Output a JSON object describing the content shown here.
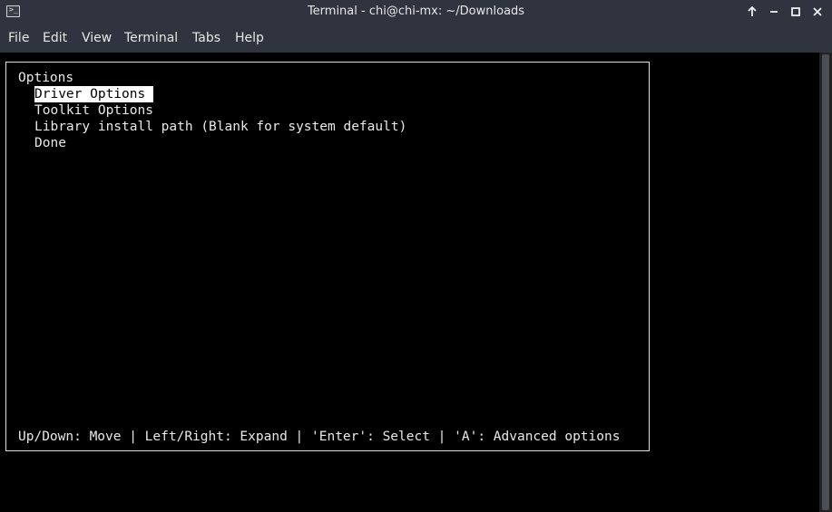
{
  "window": {
    "title": "Terminal - chi@chi-mx: ~/Downloads",
    "app_icon_glyph": ">_",
    "buttons": {
      "keep_above_icon": "arrow-up",
      "minimize_glyph": "−",
      "maximize_icon": "square",
      "close_glyph": "✕"
    }
  },
  "menubar": {
    "items": [
      "File",
      "Edit",
      "View",
      "Terminal",
      "Tabs",
      "Help"
    ]
  },
  "terminal": {
    "heading": "Options",
    "options": [
      "Driver Options",
      "Toolkit Options",
      "Library install path (Blank for system default)",
      "Done"
    ],
    "selected_index": 0,
    "footer": "Up/Down: Move | Left/Right: Expand | 'Enter': Select | 'A': Advanced options"
  },
  "colors": {
    "titlebar_bg": "#2f343f",
    "terminal_bg": "#000000",
    "terminal_fg": "#e8e8e8",
    "selection_bg": "#ffffff"
  }
}
